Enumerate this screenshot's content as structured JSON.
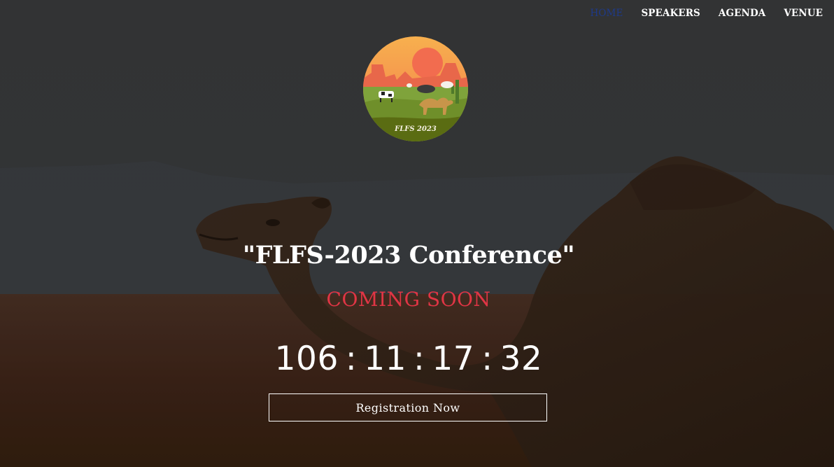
{
  "nav": {
    "items": [
      {
        "label": "HOME",
        "active": true
      },
      {
        "label": "SPEAKERS",
        "active": false
      },
      {
        "label": "AGENDA",
        "active": false
      },
      {
        "label": "VENUE",
        "active": false
      }
    ]
  },
  "logo": {
    "text": "FLFS 2023",
    "icon": "flfs-logo-icon"
  },
  "hero": {
    "title": "\"FLFS-2023 Conference\"",
    "subtitle": "COMING SOON",
    "countdown": {
      "days": "106",
      "hours": "11",
      "minutes": "17",
      "seconds": "32",
      "separator": ":"
    },
    "cta_label": "Registration Now"
  },
  "colors": {
    "accent_red": "#e03545",
    "nav_active": "#1e3a8a",
    "text": "#ffffff"
  }
}
